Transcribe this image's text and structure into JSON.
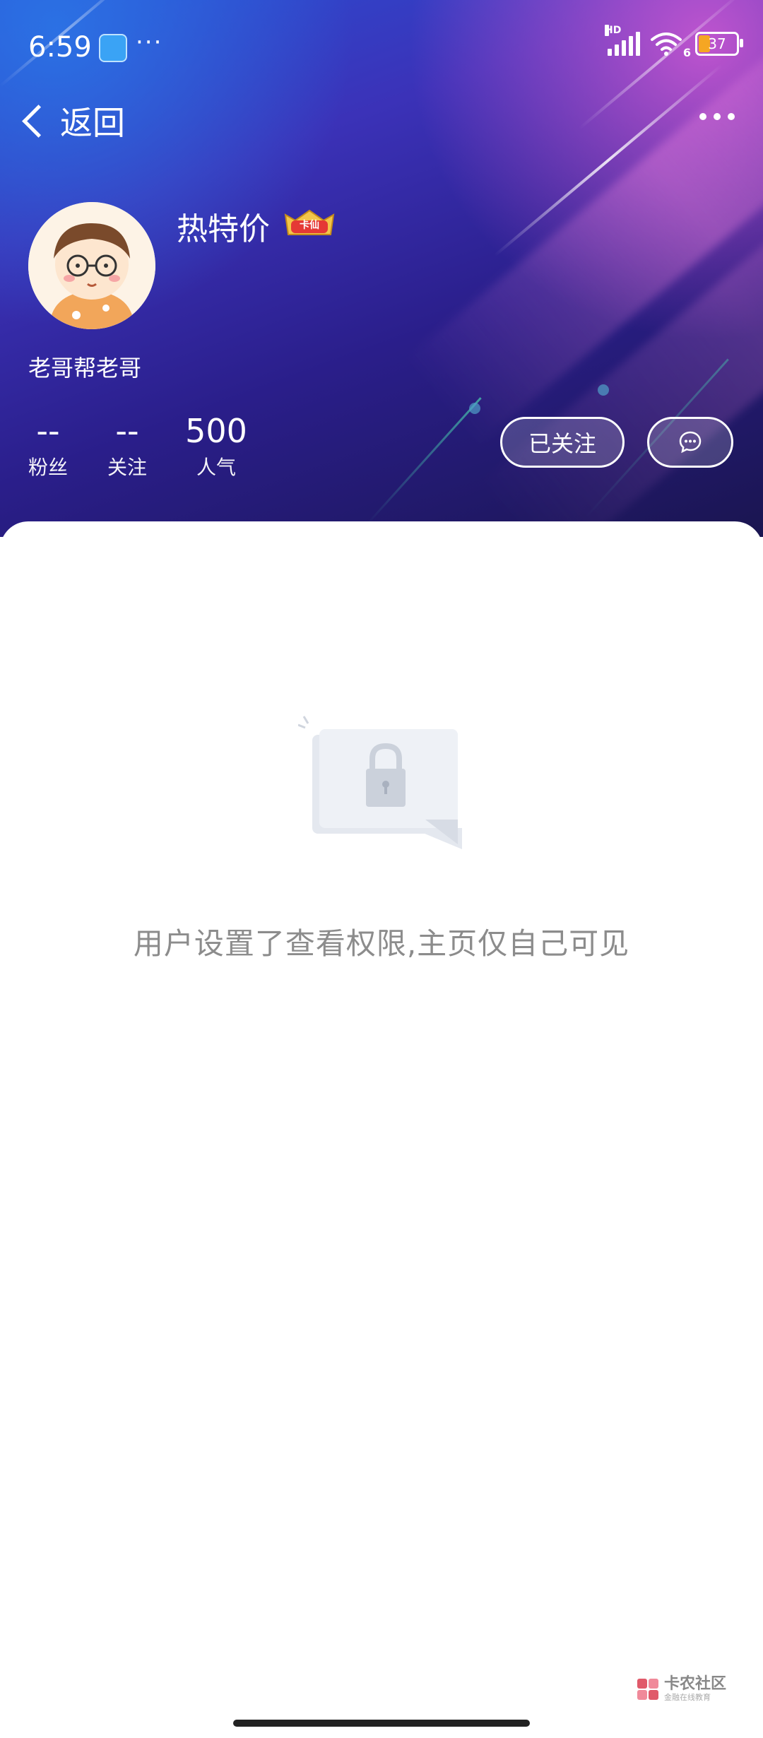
{
  "status_bar": {
    "time": "6:59",
    "more": "···",
    "network": "HD",
    "wifi_suffix": "6",
    "battery": "37"
  },
  "nav": {
    "back_label": "返回"
  },
  "profile": {
    "nickname": "热特价",
    "badge_text": "卡仙",
    "bio": "老哥帮老哥",
    "stats": [
      {
        "value": "--",
        "label": "粉丝"
      },
      {
        "value": "--",
        "label": "关注"
      },
      {
        "value": "500",
        "label": "人气"
      }
    ],
    "follow_button": "已关注"
  },
  "empty_state": {
    "message": "用户设置了查看权限,主页仅自己可见"
  },
  "watermark": {
    "title": "卡农社区",
    "subtitle": "金融在线教育"
  },
  "colors": {
    "hero_top": "#2a4fd4",
    "hero_bottom": "#1a1550",
    "accent_pink": "#d65bd4",
    "battery_fill": "#f5a623",
    "empty_text": "#8c8c8c"
  }
}
